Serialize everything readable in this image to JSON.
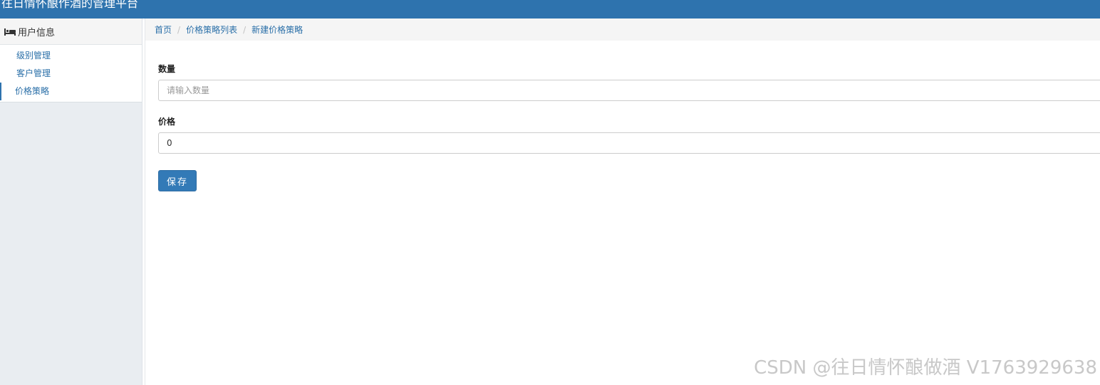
{
  "app": {
    "title": "往日情怀酿作酒的管理平台"
  },
  "sidebar": {
    "section": {
      "icon": "bed-icon",
      "label": "用户信息"
    },
    "items": [
      {
        "label": "级别管理",
        "active": false
      },
      {
        "label": "客户管理",
        "active": false
      },
      {
        "label": "价格策略",
        "active": true
      }
    ]
  },
  "breadcrumb": {
    "items": [
      "首页",
      "价格策略列表",
      "新建价格策略"
    ],
    "separator": "/"
  },
  "form": {
    "quantity": {
      "label": "数量",
      "value": "",
      "placeholder": "请输入数量"
    },
    "price": {
      "label": "价格",
      "value": "0",
      "placeholder": ""
    },
    "save_label": "保存"
  },
  "watermark": "CSDN @往日情怀酿做酒 V1763929638",
  "colors": {
    "header": "#2e73ae",
    "link": "#2a6fa8",
    "primary_button": "#337ab7"
  }
}
